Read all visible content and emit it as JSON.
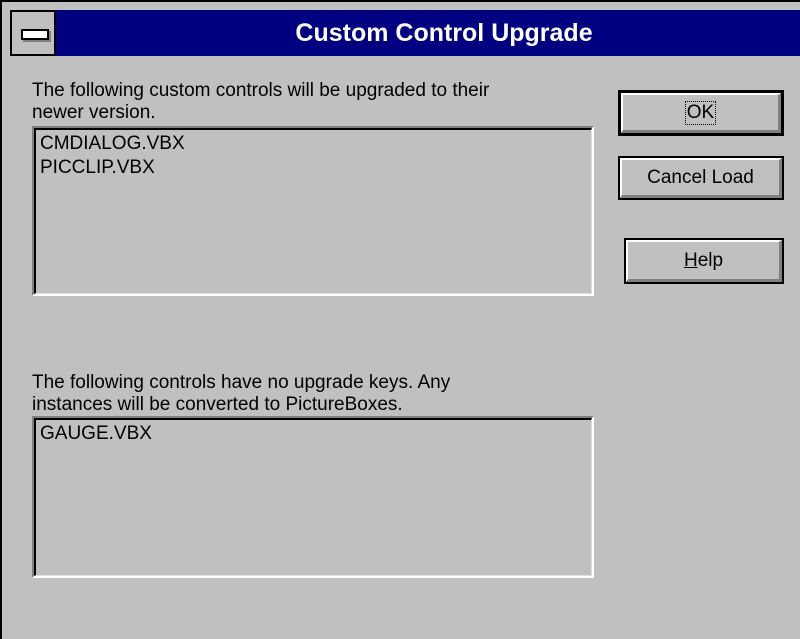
{
  "window": {
    "title": "Custom Control Upgrade"
  },
  "upgrade_section": {
    "label_line1": "The following custom controls will be upgraded to their",
    "label_line2": "newer version.",
    "items": [
      "CMDIALOG.VBX",
      "PICCLIP.VBX"
    ]
  },
  "no_upgrade_section": {
    "label_line1": "The following controls have no upgrade keys.  Any",
    "label_line2": "instances will be converted to PictureBoxes.",
    "items": [
      "GAUGE.VBX"
    ]
  },
  "buttons": {
    "ok": "OK",
    "cancel_load": "Cancel Load",
    "help": "Help"
  },
  "icons": {
    "system_menu": "system-menu-icon"
  },
  "colors": {
    "titlebar": "#000080",
    "face": "#c0c0c0"
  }
}
